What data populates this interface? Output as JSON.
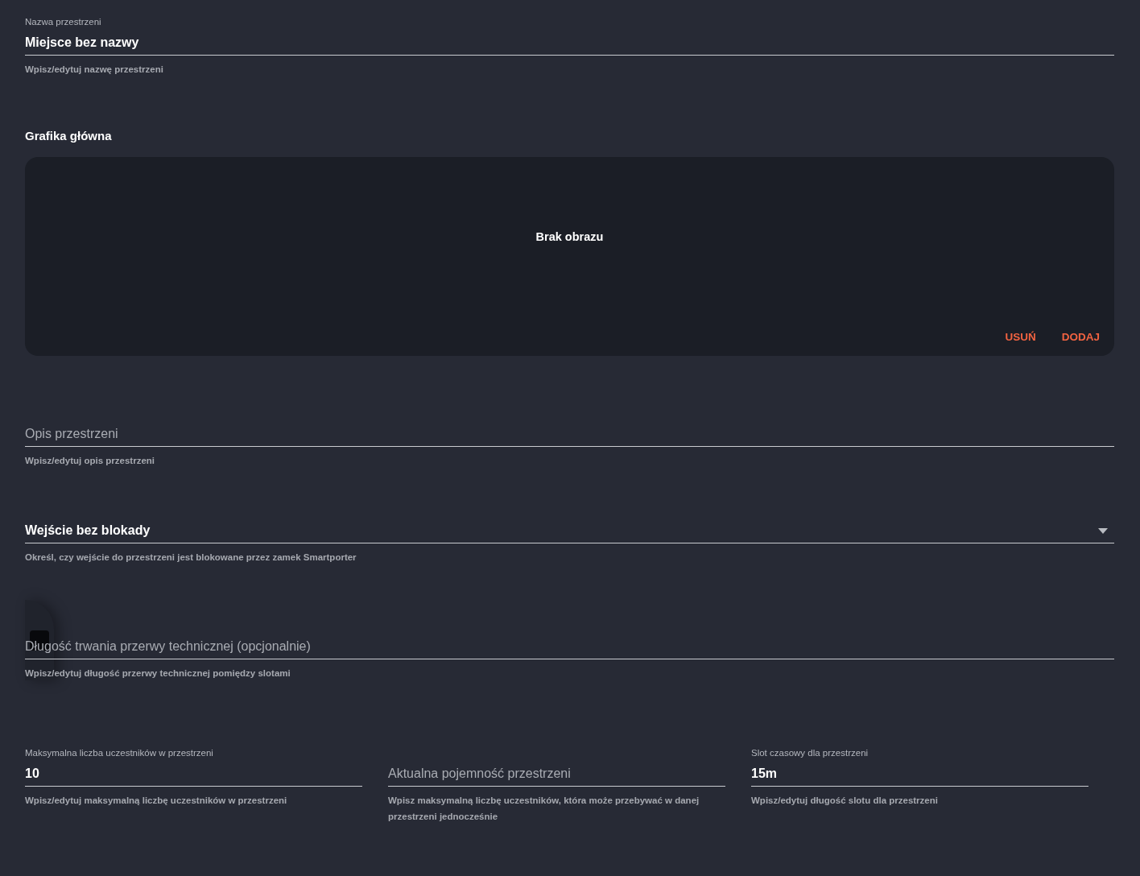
{
  "name_field": {
    "label": "Nazwa przestrzeni",
    "value": "Miejsce bez nazwy",
    "helper": "Wpisz/edytuj nazwę przestrzeni"
  },
  "image_section": {
    "title": "Grafika główna",
    "empty_text": "Brak obrazu",
    "actions": [
      "USUŃ",
      "DODAJ"
    ]
  },
  "description_field": {
    "placeholder": "Opis przestrzeni",
    "helper": "Wpisz/edytuj opis przestrzeni"
  },
  "entry_select": {
    "value": "Wejście bez blokady",
    "helper": "Określ, czy wejście do przestrzeni jest blokowane przez zamek Smartporter"
  },
  "break_field": {
    "placeholder": "Długość trwania przerwy technicznej (opcjonalnie)",
    "helper": "Wpisz/edytuj długość przerwy technicznej pomiędzy slotami"
  },
  "capacity_fields": [
    {
      "label": "Maksymalna liczba uczestników w przestrzeni",
      "value": "10",
      "helper": "Wpisz/edytuj maksymalną liczbę uczestników w przestrzeni"
    },
    {
      "placeholder": "Aktualna pojemność przestrzeni",
      "helper": "Wpisz maksymalną liczbę uczestników, która może przebywać w danej przestrzeni jednocześnie"
    },
    {
      "label": "Slot czasowy dla przestrzeni",
      "value": "15m",
      "helper": "Wpisz/edytuj długość slotu dla przestrzeni"
    }
  ]
}
